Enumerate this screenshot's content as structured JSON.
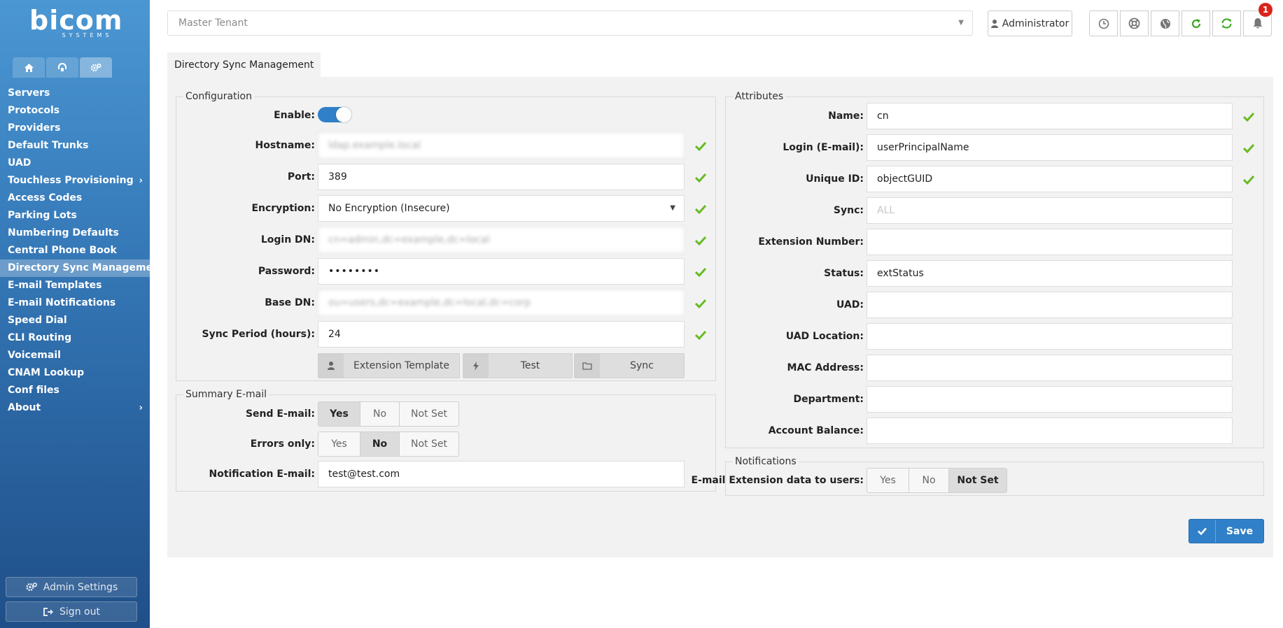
{
  "brand": {
    "name": "bicom",
    "sub": "SYSTEMS"
  },
  "sidebar": {
    "tabs": [
      {
        "icon": "home-icon"
      },
      {
        "icon": "support-icon"
      },
      {
        "icon": "cogs-icon"
      }
    ],
    "items": [
      {
        "label": "Servers"
      },
      {
        "label": "Protocols"
      },
      {
        "label": "Providers"
      },
      {
        "label": "Default Trunks"
      },
      {
        "label": "UAD"
      },
      {
        "label": "Touchless Provisioning"
      },
      {
        "label": "Access Codes"
      },
      {
        "label": "Parking Lots"
      },
      {
        "label": "Numbering Defaults"
      },
      {
        "label": "Central Phone Book"
      },
      {
        "label": "Directory Sync Management"
      },
      {
        "label": "E-mail Templates"
      },
      {
        "label": "E-mail Notifications"
      },
      {
        "label": "Speed Dial"
      },
      {
        "label": "CLI Routing"
      },
      {
        "label": "Voicemail"
      },
      {
        "label": "CNAM Lookup"
      },
      {
        "label": "Conf files"
      },
      {
        "label": "About"
      }
    ],
    "admin_settings": "Admin Settings",
    "sign_out": "Sign out"
  },
  "header": {
    "tenant": "Master Tenant",
    "user": "Administrator",
    "notifications_count": "1"
  },
  "page": {
    "tab": "Directory Sync Management"
  },
  "configuration": {
    "legend": "Configuration",
    "enable_label": "Enable:",
    "hostname_label": "Hostname:",
    "hostname": "ldap.example.local",
    "port_label": "Port:",
    "port": "389",
    "encryption_label": "Encryption:",
    "encryption": "No Encryption (Insecure)",
    "login_dn_label": "Login DN:",
    "login_dn": "cn=admin,dc=example,dc=local",
    "password_label": "Password:",
    "password": "••••••••",
    "base_dn_label": "Base DN:",
    "base_dn": "ou=users,dc=example,dc=local,dc=corp",
    "sync_period_label": "Sync Period (hours):",
    "sync_period": "24",
    "btn_template": "Extension Template",
    "btn_test": "Test",
    "btn_sync": "Sync"
  },
  "summary": {
    "legend": "Summary E-mail",
    "send_label": "Send E-mail:",
    "errors_label": "Errors only:",
    "email_label": "Notification E-mail:",
    "email": "test@test.com",
    "opt_yes": "Yes",
    "opt_no": "No",
    "opt_notset": "Not Set"
  },
  "attributes": {
    "legend": "Attributes",
    "fields": [
      {
        "label": "Name:",
        "value": "cn",
        "check": true
      },
      {
        "label": "Login (E-mail):",
        "value": "userPrincipalName",
        "check": true
      },
      {
        "label": "Unique ID:",
        "value": "objectGUID",
        "check": true
      },
      {
        "label": "Sync:",
        "value": "",
        "placeholder": "ALL",
        "check": false
      },
      {
        "label": "Extension Number:",
        "value": "",
        "check": false
      },
      {
        "label": "Status:",
        "value": "extStatus",
        "check": false
      },
      {
        "label": "UAD:",
        "value": "",
        "check": false
      },
      {
        "label": "UAD Location:",
        "value": "",
        "check": false
      },
      {
        "label": "MAC Address:",
        "value": "",
        "check": false
      },
      {
        "label": "Department:",
        "value": "",
        "check": false
      },
      {
        "label": "Account Balance:",
        "value": "",
        "check": false
      }
    ]
  },
  "notifications": {
    "legend": "Notifications",
    "label": "E-mail Extension data to users:",
    "opt_yes": "Yes",
    "opt_no": "No",
    "opt_notset": "Not Set"
  },
  "save_label": "Save",
  "colors": {
    "accent": "#2f80c8",
    "check": "#66bb22",
    "refresh": "#3aa81e",
    "badge": "#d9241b"
  }
}
